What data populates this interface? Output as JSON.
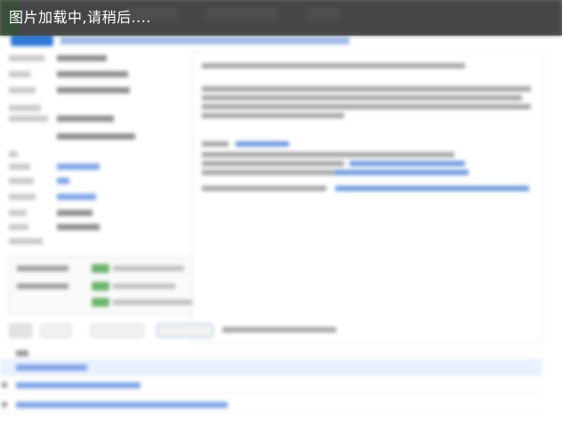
{
  "overlay": {
    "loading_text": "图片加载中,请稍后...."
  }
}
